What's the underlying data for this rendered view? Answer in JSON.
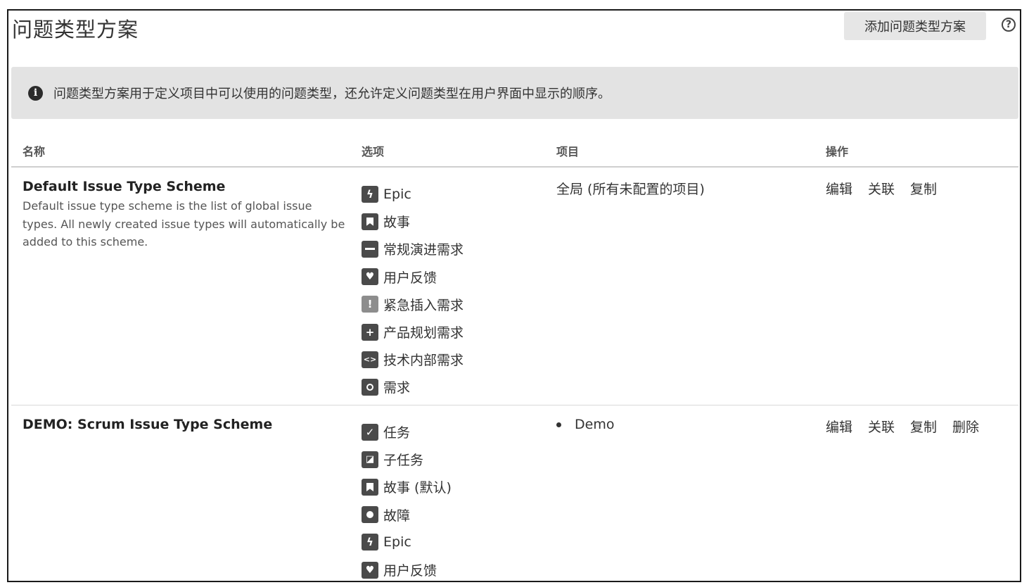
{
  "page": {
    "title": "问题类型方案",
    "add_button": "添加问题类型方案",
    "help": "?"
  },
  "banner": {
    "text": "问题类型方案用于定义项目中可以使用的问题类型，还允许定义问题类型在用户界面中显示的顺序。"
  },
  "table": {
    "headers": {
      "name": "名称",
      "options": "选项",
      "projects": "项目",
      "actions": "操作"
    },
    "rows": [
      {
        "name": "Default Issue Type Scheme",
        "description": "Default issue type scheme is the list of global issue types. All newly created issue types will automatically be added to this scheme.",
        "options": [
          {
            "icon": "lightning-icon",
            "label": "Epic"
          },
          {
            "icon": "bookmark-icon",
            "label": "故事"
          },
          {
            "icon": "minus-icon",
            "label": "常规演进需求"
          },
          {
            "icon": "heart-icon",
            "label": "用户反馈"
          },
          {
            "icon": "exclamation-icon",
            "label": "紧急插入需求"
          },
          {
            "icon": "plus-icon",
            "label": "产品规划需求"
          },
          {
            "icon": "code-icon",
            "label": "技术内部需求"
          },
          {
            "icon": "circle-icon",
            "label": "需求"
          }
        ],
        "project": "全局 (所有未配置的项目)",
        "actions": [
          "编辑",
          "关联",
          "复制"
        ]
      },
      {
        "name": "DEMO: Scrum Issue Type Scheme",
        "description": "",
        "options": [
          {
            "icon": "checkmark-icon",
            "label": "任务"
          },
          {
            "icon": "subtask-icon",
            "label": "子任务"
          },
          {
            "icon": "bookmark-icon",
            "label": "故事 (默认)"
          },
          {
            "icon": "bug-icon",
            "label": "故障"
          },
          {
            "icon": "lightning-icon",
            "label": "Epic"
          },
          {
            "icon": "heart-icon",
            "label": "用户反馈"
          }
        ],
        "project": "Demo",
        "actions": [
          "编辑",
          "关联",
          "复制",
          "删除"
        ]
      }
    ]
  }
}
